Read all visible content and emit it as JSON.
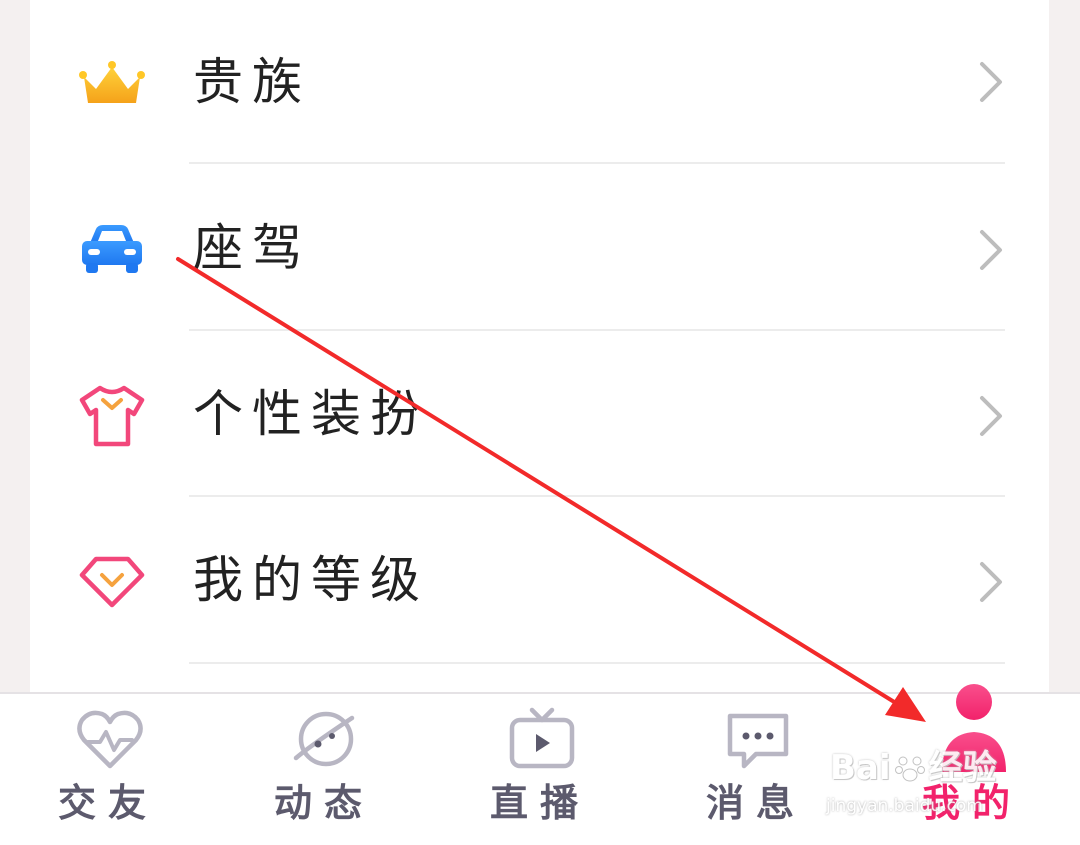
{
  "menu": {
    "items": [
      {
        "label": "贵族",
        "icon": "crown-icon"
      },
      {
        "label": "座驾",
        "icon": "car-icon"
      },
      {
        "label": "个性装扮",
        "icon": "tshirt-icon"
      },
      {
        "label": "我的等级",
        "icon": "diamond-icon"
      }
    ]
  },
  "tabbar": {
    "tabs": [
      {
        "label": "交友",
        "icon": "heart-pulse-icon"
      },
      {
        "label": "动态",
        "icon": "planet-icon"
      },
      {
        "label": "直播",
        "icon": "tv-play-icon"
      },
      {
        "label": "消息",
        "icon": "message-icon"
      },
      {
        "label": "我的",
        "icon": "user-icon"
      }
    ],
    "active_index": 4
  },
  "watermark": {
    "brand": "Bai",
    "brand_suffix": "经验",
    "url": "jingyan.baidu.com"
  },
  "colors": {
    "accent": "#f2226b",
    "tab_inactive": "#5c5a6d",
    "annotation_arrow": "#f22a2a"
  }
}
